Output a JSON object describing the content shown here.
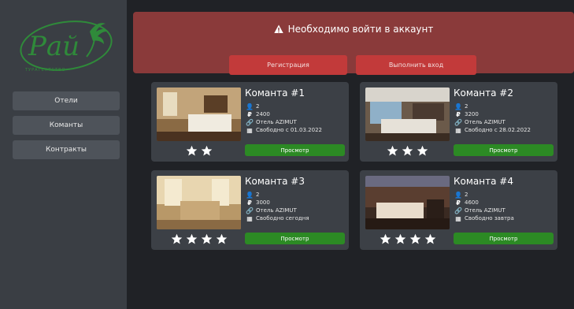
{
  "logo": {
    "brand": "Рай",
    "tagline": "ТУРАГЕНТСТВО"
  },
  "nav": {
    "items": [
      {
        "label": "Отели"
      },
      {
        "label": "Команты"
      },
      {
        "label": "Контракты"
      }
    ]
  },
  "alert": {
    "message": "Необходимо войти в аккаунт",
    "register_label": "Регистрация",
    "login_label": "Выполнить вход"
  },
  "rooms": [
    {
      "title": "Команта #1",
      "guests": "2",
      "price": "2400",
      "hotel": "Отель AZIMUT",
      "availability": "Свободно с 01.03.2022",
      "stars": 2,
      "view_label": "Просмотр"
    },
    {
      "title": "Команта #2",
      "guests": "2",
      "price": "3200",
      "hotel": "Отель AZIMUT",
      "availability": "Свободно с 28.02.2022",
      "stars": 3,
      "view_label": "Просмотр"
    },
    {
      "title": "Команта #3",
      "guests": "2",
      "price": "3000",
      "hotel": "Отель AZIMUT",
      "availability": "Свободно сегодня",
      "stars": 4,
      "view_label": "Просмотр"
    },
    {
      "title": "Команта #4",
      "guests": "2",
      "price": "4600",
      "hotel": "Отель AZIMUT",
      "availability": "Свободно завтра",
      "stars": 4,
      "view_label": "Просмотр"
    }
  ],
  "colors": {
    "alert_bg": "#8a3a3a",
    "button_red": "#c23a3a",
    "button_green": "#2c8a24",
    "logo_green": "#2f8a3a"
  }
}
